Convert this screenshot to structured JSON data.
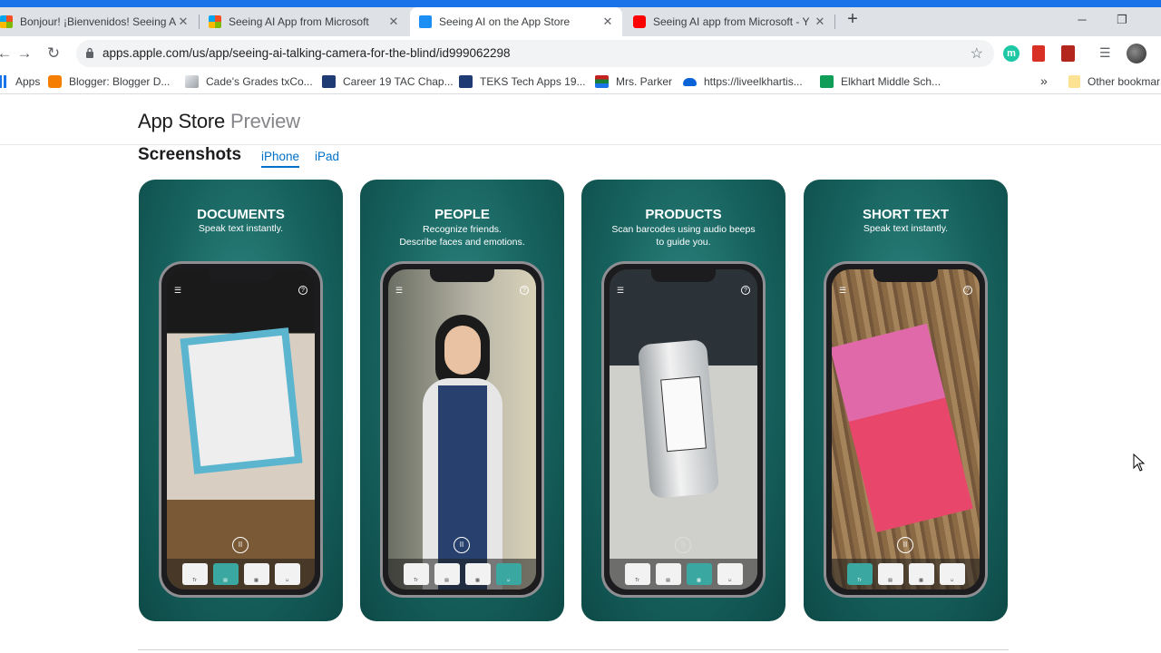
{
  "browser": {
    "tabs": [
      {
        "title": "Bonjour! ¡Bienvenidos! Seeing AI"
      },
      {
        "title": "Seeing AI App from Microsoft"
      },
      {
        "title": "Seeing AI on the App Store"
      },
      {
        "title": "Seeing AI app from Microsoft - Y"
      }
    ],
    "url": "apps.apple.com/us/app/seeing-ai-talking-camera-for-the-blind/id999062298",
    "bookmarks": [
      "Apps",
      "Blogger: Blogger D...",
      "Cade's Grades txCo...",
      "Career 19 TAC Chap...",
      "TEKS Tech Apps 19...",
      "Mrs. Parker",
      "https://liveelkhartis...",
      "Elkhart Middle Sch..."
    ],
    "other_bookmarks": "Other bookmar",
    "more_bookmarks": "»"
  },
  "header": {
    "brand": "App Store",
    "preview": "Preview"
  },
  "screenshots": {
    "title": "Screenshots",
    "tabs": [
      "iPhone",
      "iPad"
    ],
    "cards": [
      {
        "title": "DOCUMENTS",
        "subtitle": "Speak text instantly."
      },
      {
        "title": "PEOPLE",
        "subtitle": "Recognize friends.\nDescribe faces and emotions."
      },
      {
        "title": "PRODUCTS",
        "subtitle": "Scan barcodes using audio beeps\nto guide you."
      },
      {
        "title": "SHORT TEXT",
        "subtitle": "Speak text instantly."
      }
    ]
  },
  "colors": {
    "accent": "#0070c9",
    "card_teal": "#17625e",
    "chrome_blue": "#1a73e8"
  }
}
